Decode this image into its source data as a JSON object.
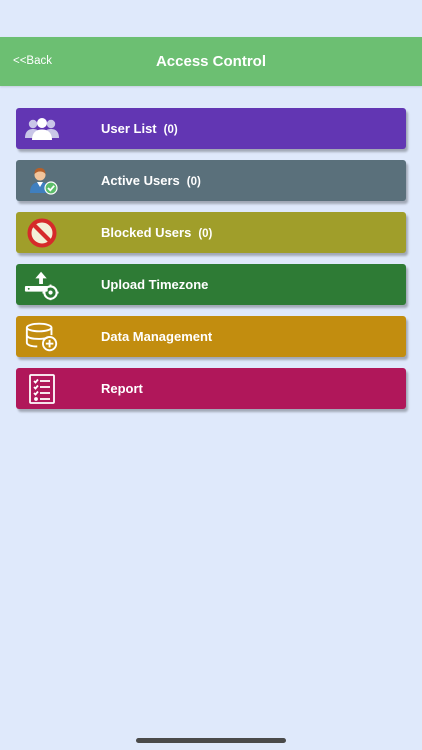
{
  "header": {
    "back_label": "<<Back",
    "title": "Access Control",
    "background": "#6cbf72"
  },
  "menu": {
    "items": [
      {
        "label": "User List",
        "count": "(0)",
        "icon": "users-group-icon",
        "color": "#6236b3"
      },
      {
        "label": "Active Users",
        "count": "(0)",
        "icon": "active-user-icon",
        "color": "#5a707b"
      },
      {
        "label": "Blocked Users",
        "count": "(0)",
        "icon": "blocked-icon",
        "color": "#a09e2a"
      },
      {
        "label": "Upload Timezone",
        "count": "",
        "icon": "upload-settings-icon",
        "color": "#2e7b35"
      },
      {
        "label": "Data Management",
        "count": "",
        "icon": "database-add-icon",
        "color": "#c28d0f"
      },
      {
        "label": "Report",
        "count": "",
        "icon": "checklist-report-icon",
        "color": "#b0175a"
      }
    ]
  }
}
